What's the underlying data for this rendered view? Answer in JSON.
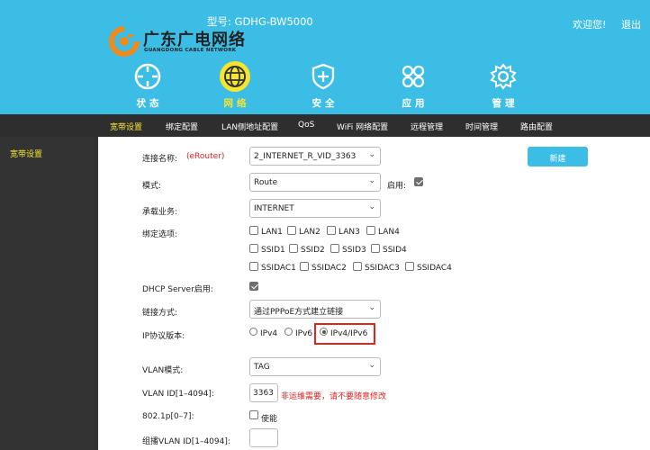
{
  "header": {
    "model": "型号: GDHG-BW5000",
    "logo_cn": "广东广电网络",
    "logo_en": "GUANGDONG CABLE NETWORK",
    "welcome": "欢迎您!",
    "logout": "退出"
  },
  "nav": [
    {
      "label": "状态",
      "icon": "status-icon"
    },
    {
      "label": "网络",
      "icon": "globe-icon",
      "active": true
    },
    {
      "label": "安全",
      "icon": "shield-icon"
    },
    {
      "label": "应用",
      "icon": "apps-icon"
    },
    {
      "label": "管理",
      "icon": "gear-icon"
    }
  ],
  "subnav": [
    "宽带设置",
    "绑定配置",
    "LAN侧地址配置",
    "QoS",
    "WiFi 网络配置",
    "远程管理",
    "时间管理",
    "路由配置"
  ],
  "sidebar": {
    "item": "宽带设置"
  },
  "form": {
    "connection_name_label": "连接名称:",
    "connection_name_note": "(eRouter)",
    "connection_name_value": "2_INTERNET_R_VID_3363",
    "new_button": "新建",
    "mode_label": "模式:",
    "mode_value": "Route",
    "enable_label": "启用:",
    "service_label": "承载业务:",
    "service_value": "INTERNET",
    "bind_label": "绑定选项:",
    "bind_options": [
      "LAN1",
      "LAN2",
      "LAN3",
      "LAN4",
      "SSID1",
      "SSID2",
      "SSID3",
      "SSID4",
      "SSIDAC1",
      "SSIDAC2",
      "SSIDAC3",
      "SSIDAC4"
    ],
    "dhcp_label": "DHCP Server启用:",
    "link_label": "链接方式:",
    "link_value": "通过PPPoE方式建立链接",
    "ip_version_label": "IP协议版本:",
    "ip_options": [
      "IPv4",
      "IPv6",
      "IPv4/IPv6"
    ],
    "ip_selected": "IPv4/IPv6",
    "vlan_mode_label": "VLAN模式:",
    "vlan_mode_value": "TAG",
    "vlan_id_label": "VLAN ID[1–4094]:",
    "vlan_id_value": "3363",
    "vlan_id_warning": "非运维需要，请不要随意修改",
    "p8021_label": "802.1p[0–7]:",
    "p8021_option": "使能",
    "group_vlan_label": "组播VLAN ID[1–4094]:"
  },
  "colors": {
    "header": "#3bbde6",
    "accent": "#f6e52d",
    "dark": "#2e2e2e",
    "warning": "#e02020"
  }
}
